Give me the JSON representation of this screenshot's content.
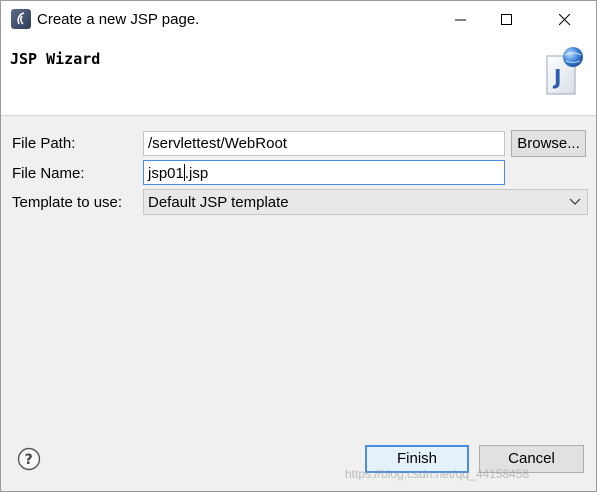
{
  "window": {
    "title": "Create a new JSP page.",
    "controls": [
      "minimize-icon",
      "maximize-icon",
      "close-icon"
    ]
  },
  "banner": {
    "title": "JSP Wizard",
    "image_icon": "jsp-file-icon"
  },
  "form": {
    "file_path": {
      "label": "File Path:",
      "value": "/servlettest/WebRoot"
    },
    "browse_label": "Browse...",
    "file_name": {
      "label": "File Name:",
      "value_before_caret": "jsp01",
      "value_after_caret": ".jsp"
    },
    "template": {
      "label": "Template to use:",
      "value": "Default JSP template"
    }
  },
  "footer": {
    "help_icon": "help-icon",
    "finish_label": "Finish",
    "cancel_label": "Cancel"
  },
  "watermark": "https://blog.csdn.net/qq_44158458",
  "colors": {
    "focus_border": "#4a8de0",
    "dialog_background": "#f0f0f0",
    "banner_background": "#ffffff"
  }
}
